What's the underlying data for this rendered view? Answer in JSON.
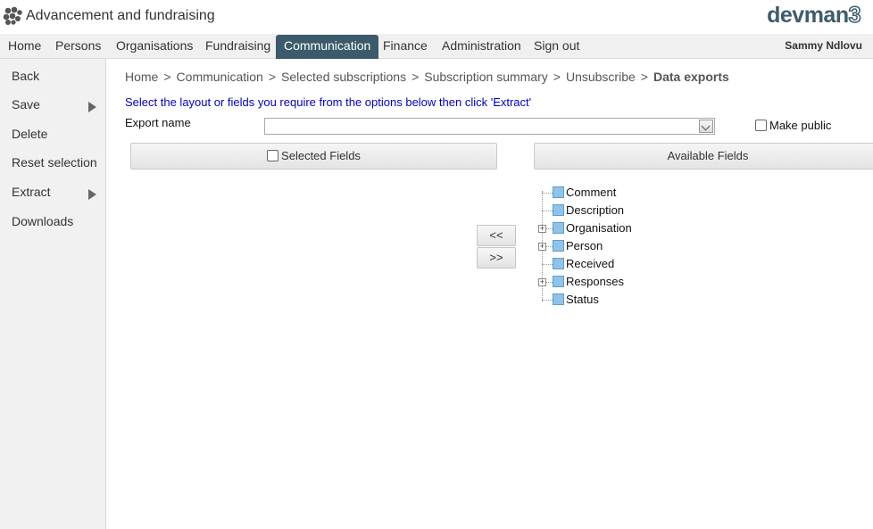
{
  "app": {
    "title": "Advancement and fundraising",
    "brand_text": "devman",
    "brand_num": "3"
  },
  "nav": {
    "items": [
      {
        "label": "Home"
      },
      {
        "label": "Persons"
      },
      {
        "label": "Organisations"
      },
      {
        "label": "Fundraising"
      },
      {
        "label": "Communication"
      },
      {
        "label": "Finance"
      },
      {
        "label": "Administration"
      },
      {
        "label": "Sign out"
      }
    ],
    "active": "Communication",
    "user": "Sammy Ndlovu"
  },
  "sidebar": {
    "items": [
      {
        "label": "Back"
      },
      {
        "label": "Save"
      },
      {
        "label": "Delete"
      },
      {
        "label": "Reset selection"
      },
      {
        "label": "Extract"
      },
      {
        "label": "Downloads"
      }
    ]
  },
  "breadcrumb": {
    "items": [
      "Home",
      "Communication",
      "Selected subscriptions",
      "Subscription summary",
      "Unsubscribe"
    ],
    "separator": ">",
    "current": "Data exports"
  },
  "main": {
    "instructions": "Select the layout or fields you require from the options below then click 'Extract'",
    "export_name_label": "Export name",
    "export_name_value": "",
    "make_public_label": "Make public",
    "selected_fields_label": "Selected Fields",
    "available_fields_label": "Available Fields",
    "move_left_label": "<<",
    "move_right_label": ">>"
  },
  "tree": {
    "items": [
      {
        "label": "Comment",
        "expandable": false
      },
      {
        "label": "Description",
        "expandable": false
      },
      {
        "label": "Organisation",
        "expandable": true
      },
      {
        "label": "Person",
        "expandable": true
      },
      {
        "label": "Received",
        "expandable": false
      },
      {
        "label": "Responses",
        "expandable": true
      },
      {
        "label": "Status",
        "expandable": false
      }
    ]
  },
  "colors": {
    "nav_active_bg": "#3b5b6c",
    "brand": "#3e5b6d",
    "instructions": "#0000cc",
    "tree_checkbox": "#8fc3ea"
  }
}
